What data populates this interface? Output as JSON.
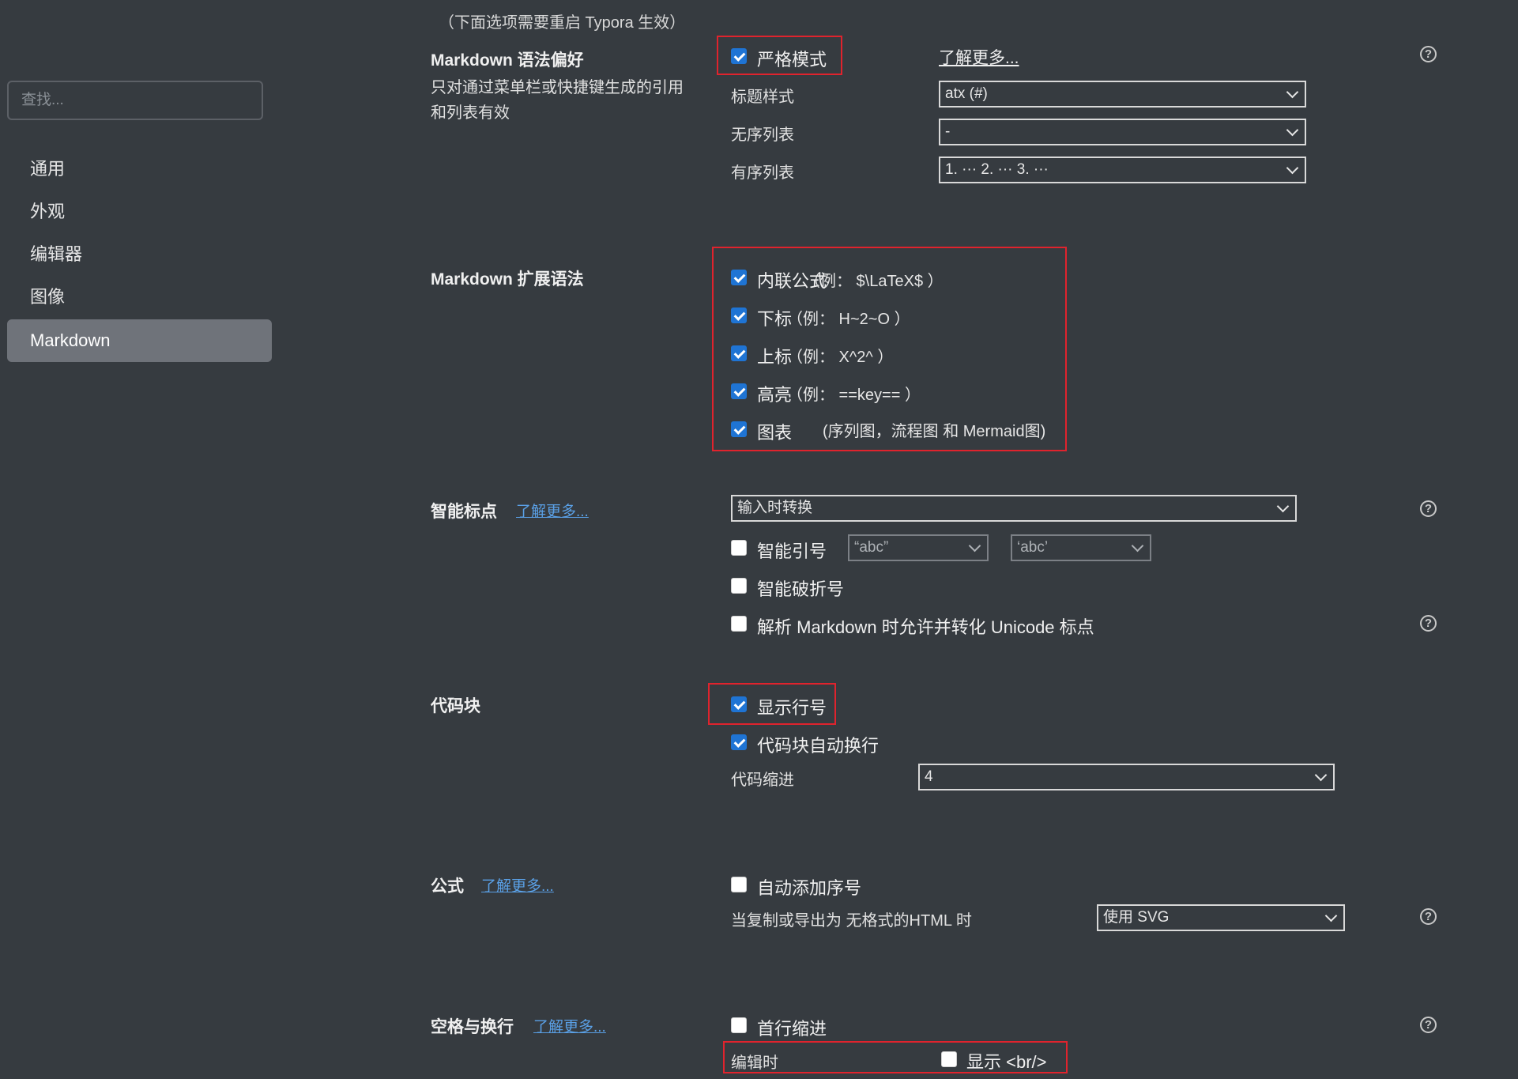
{
  "top_note": "（下面选项需要重启 Typora 生效）",
  "sidebar": {
    "search_placeholder": "查找...",
    "items": [
      {
        "label": "通用"
      },
      {
        "label": "外观"
      },
      {
        "label": "编辑器"
      },
      {
        "label": "图像"
      },
      {
        "label": "Markdown",
        "active": true
      }
    ]
  },
  "syntax_pref": {
    "title": "Markdown 语法偏好",
    "description_line1": "只对通过菜单栏或快捷键生成的引用",
    "description_line2": "和列表有效",
    "strict_mode": {
      "label": "严格模式",
      "checked": true
    },
    "learn_more": "了解更多...",
    "heading_style": {
      "label": "标题样式",
      "value": "atx (#)"
    },
    "unordered_list": {
      "label": "无序列表",
      "value": "-"
    },
    "ordered_list": {
      "label": "有序列表",
      "value": "1. ··· 2. ··· 3. ···"
    }
  },
  "extended_syntax": {
    "title": "Markdown 扩展语法",
    "options": [
      {
        "label": "内联公式",
        "example": "（例： $\\LaTeX$ ）",
        "checked": true
      },
      {
        "label": "下标",
        "example": "（例： H~2~O ）",
        "checked": true
      },
      {
        "label": "上标",
        "example": "（例： X^2^ ）",
        "checked": true
      },
      {
        "label": "高亮",
        "example": "（例： ==key== ）",
        "checked": true
      },
      {
        "label": "图表",
        "example": "(序列图，流程图 和 Mermaid图)",
        "checked": true
      }
    ]
  },
  "smart_punct": {
    "title": "智能标点",
    "learn_more": "了解更多...",
    "mode": "输入时转换",
    "smart_quotes": {
      "label": "智能引号",
      "checked": false,
      "double_value": "“abc”",
      "single_value": "‘abc’"
    },
    "smart_dash": {
      "label": "智能破折号",
      "checked": false
    },
    "unicode_punct": {
      "label": "解析 Markdown 时允许并转化 Unicode 标点",
      "checked": false
    }
  },
  "code_block": {
    "title": "代码块",
    "line_numbers": {
      "label": "显示行号",
      "checked": true
    },
    "auto_wrap": {
      "label": "代码块自动换行",
      "checked": true
    },
    "indent": {
      "label": "代码缩进",
      "value": "4"
    }
  },
  "math": {
    "title": "公式",
    "learn_more": "了解更多...",
    "auto_number": {
      "label": "自动添加序号",
      "checked": false
    },
    "export_label": "当复制或导出为 无格式的HTML 时",
    "export_value": "使用 SVG"
  },
  "whitespace": {
    "title": "空格与换行",
    "learn_more": "了解更多...",
    "first_line_indent": {
      "label": "首行缩进",
      "checked": false
    },
    "editing_label": "编辑时",
    "show_br": {
      "label": "显示 <br/>",
      "checked": false
    }
  },
  "help_glyph": "?",
  "colors": {
    "background": "#363b40",
    "active_nav": "#6f737a",
    "checkbox_on": "#1f74d4",
    "link": "#5aa0e6",
    "highlight": "#e0232d"
  }
}
